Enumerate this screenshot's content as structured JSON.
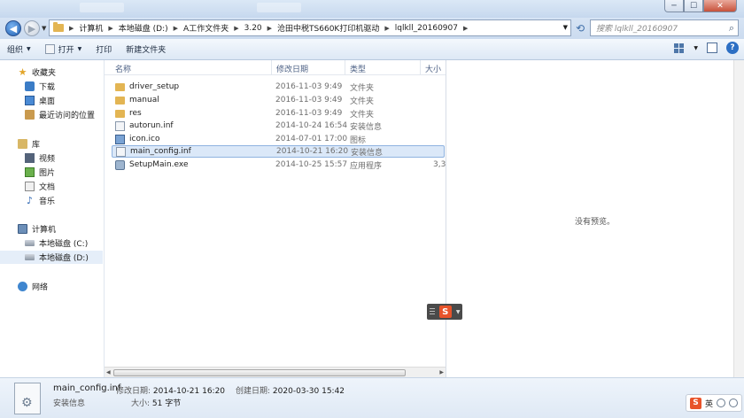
{
  "window": {
    "tab_hint_1": "",
    "minimize": "─",
    "maximize": "☐",
    "close": "✕"
  },
  "address": {
    "crumbs": [
      "计算机",
      "本地磁盘 (D:)",
      "A工作文件夹",
      "3.20",
      "沧田中税TS660K打印机驱动",
      "lqlkll_20160907"
    ],
    "search_placeholder": "搜索 lqlkll_20160907"
  },
  "toolbar": {
    "organize": "组织",
    "open": "打开",
    "print": "打印",
    "new_folder": "新建文件夹"
  },
  "sidebar": {
    "favorites": "收藏夹",
    "downloads": "下载",
    "desktop": "桌面",
    "recent": "最近访问的位置",
    "libraries": "库",
    "videos": "视频",
    "pictures": "图片",
    "documents": "文档",
    "music": "音乐",
    "computer": "计算机",
    "drive_c": "本地磁盘 (C:)",
    "drive_d": "本地磁盘 (D:)",
    "network": "网络"
  },
  "columns": {
    "name": "名称",
    "modified": "修改日期",
    "type": "类型",
    "size": "大小"
  },
  "files": [
    {
      "name": "driver_setup",
      "date": "2016-11-03 9:49",
      "type": "文件夹",
      "size": ""
    },
    {
      "name": "manual",
      "date": "2016-11-03 9:49",
      "type": "文件夹",
      "size": ""
    },
    {
      "name": "res",
      "date": "2016-11-03 9:49",
      "type": "文件夹",
      "size": ""
    },
    {
      "name": "autorun.inf",
      "date": "2014-10-24 16:54",
      "type": "安装信息",
      "size": ""
    },
    {
      "name": "icon.ico",
      "date": "2014-07-01 17:00",
      "type": "图标",
      "size": ""
    },
    {
      "name": "main_config.inf",
      "date": "2014-10-21 16:20",
      "type": "安装信息",
      "size": ""
    },
    {
      "name": "SetupMain.exe",
      "date": "2014-10-25 15:57",
      "type": "应用程序",
      "size": "3,3"
    }
  ],
  "preview": {
    "message": "没有预览。"
  },
  "ime": {
    "logo": "S"
  },
  "details": {
    "name": "main_config.inf",
    "type": "安装信息",
    "modified_label": "修改日期:",
    "modified_value": "2014-10-21 16:20",
    "created_label": "创建日期:",
    "created_value": "2020-03-30 15:42",
    "size_label": "大小:",
    "size_value": "51 字节"
  },
  "tray": {
    "logo": "S",
    "lang": "英"
  }
}
